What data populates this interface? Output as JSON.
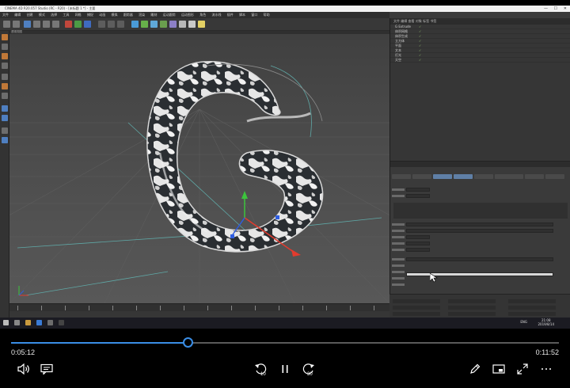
{
  "window": {
    "title": "CINEMA 4D R20.057 Studio (RC - R20) - [未标题 1 *] - 主要",
    "controls": [
      "—",
      "☐",
      "✕"
    ]
  },
  "c4d": {
    "menu": [
      "文件",
      "编辑",
      "创建",
      "模式",
      "选择",
      "工具",
      "网格",
      "捕捉",
      "动画",
      "模拟",
      "跟踪器",
      "渲染",
      "雕刻",
      "运动跟踪",
      "运动图形",
      "角色",
      "流水线",
      "插件",
      "脚本",
      "窗口",
      "帮助"
    ],
    "viewport_label": "透视视图",
    "object_manager_head": "文件 编辑 查看 对象 标签 书签",
    "objects": [
      {
        "name": "G Extrude",
        "tag": "✓"
      },
      {
        "name": "体积网格",
        "tag": "✓"
      },
      {
        "name": "体积生成",
        "tag": "✓"
      },
      {
        "name": "立方体",
        "tag": "✓"
      },
      {
        "name": "平面",
        "tag": "✓"
      },
      {
        "name": "文本",
        "tag": "✓"
      },
      {
        "name": "灯光",
        "tag": "✓"
      },
      {
        "name": "天空",
        "tag": "✓"
      }
    ],
    "taskbar_time": "21:08",
    "taskbar_date": "2019/8/14",
    "taskbar_lang": "ENG"
  },
  "player": {
    "current_time": "0:05:12",
    "total_time": "0:11:52",
    "progress": 0.3227,
    "skip_back_seconds": "10",
    "skip_forward_seconds": "30",
    "accent_color": "#3a8ee6"
  },
  "icons": {
    "volume": "volume-icon",
    "subtitles": "subtitles-icon",
    "skip_back": "skip-back-10-icon",
    "pause": "pause-icon",
    "skip_forward": "skip-forward-30-icon",
    "edit": "pen-icon",
    "mini_view": "mini-view-icon",
    "fullscreen": "fullscreen-icon",
    "more": "more-icon"
  }
}
